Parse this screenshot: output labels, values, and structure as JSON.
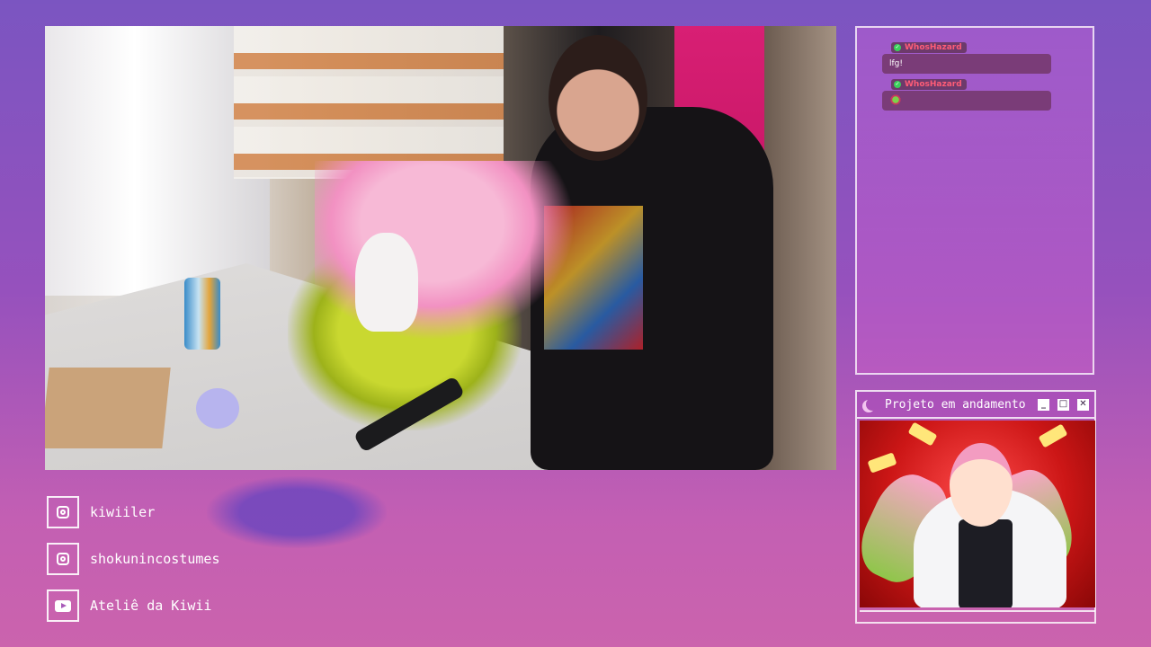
{
  "chat": {
    "messages": [
      {
        "user": "WhosHazard",
        "text": "lfg!"
      },
      {
        "user": "WhosHazard",
        "text": "",
        "emote": "green-demon-emote"
      }
    ],
    "colors": {
      "username": "#ff5c77",
      "badge": "#3ad05b",
      "bubble": "#7a3c78"
    }
  },
  "project_window": {
    "title": "Projeto em andamento",
    "icon": "moon-icon",
    "buttons": [
      "minimize",
      "maximize",
      "close"
    ]
  },
  "socials": [
    {
      "icon": "instagram-icon",
      "label": "kiwiiler"
    },
    {
      "icon": "instagram-icon",
      "label": "shokunincostumes"
    },
    {
      "icon": "youtube-icon",
      "label": "Ateliê da Kiwii"
    }
  ]
}
